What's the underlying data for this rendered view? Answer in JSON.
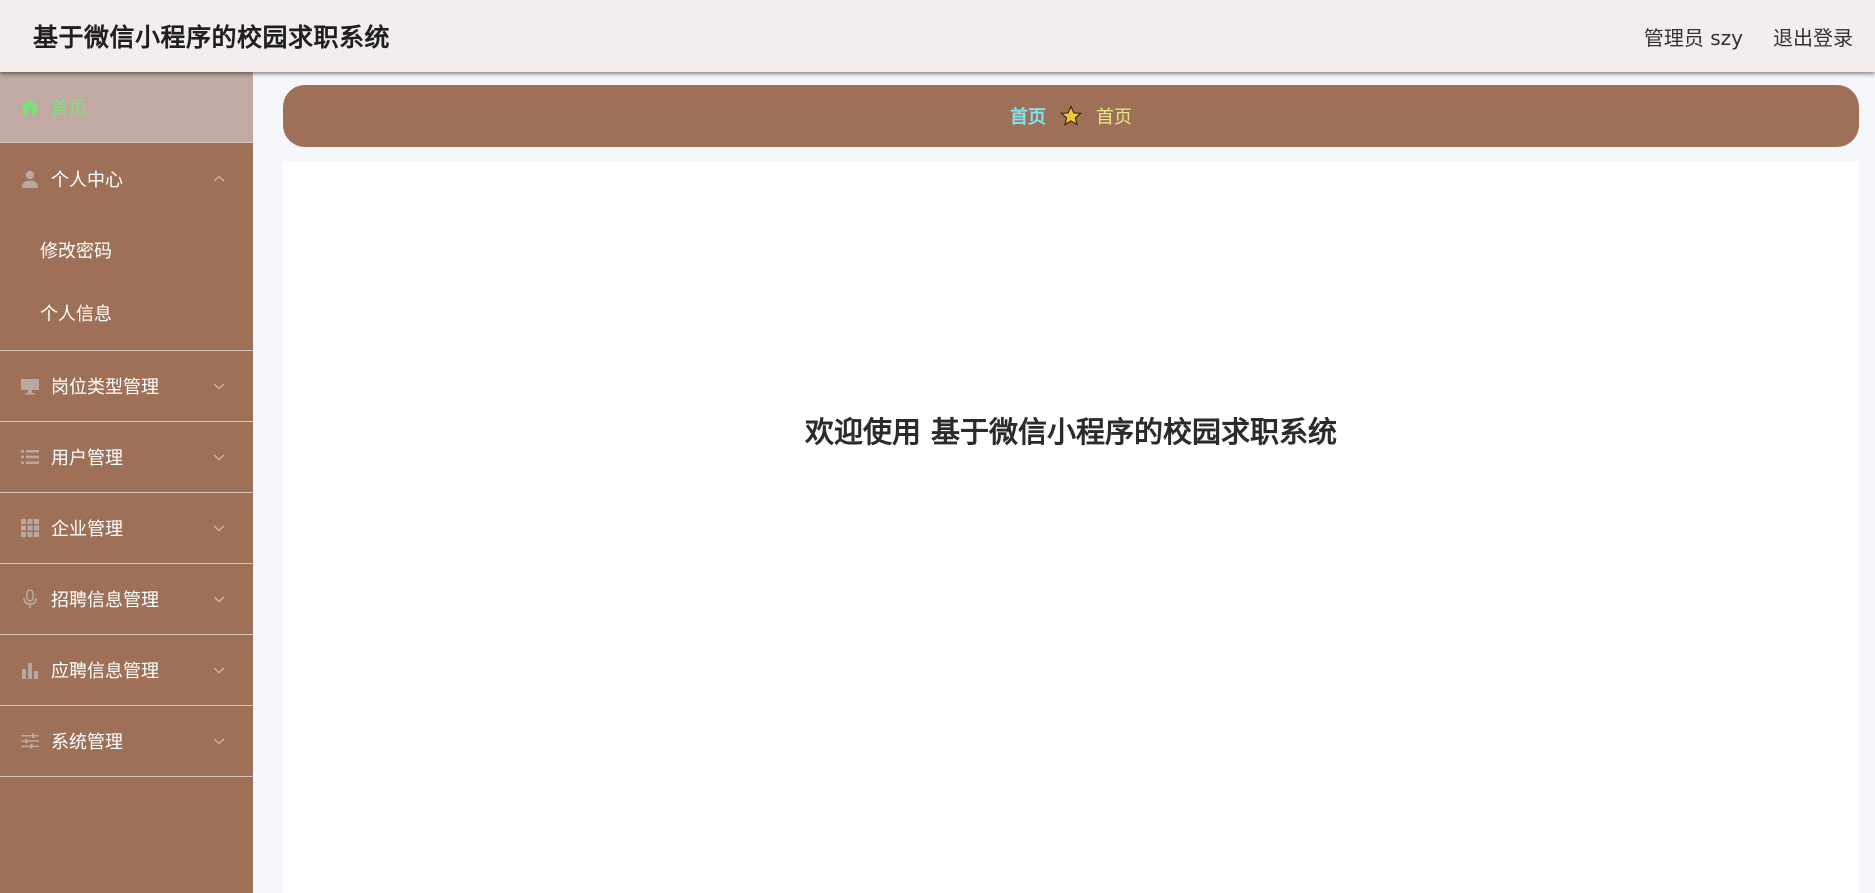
{
  "header": {
    "title": "基于微信小程序的校园求职系统",
    "user_label": "管理员 szy",
    "logout_label": "退出登录"
  },
  "sidebar": {
    "items": [
      {
        "label": "首页",
        "icon": "home-icon",
        "active": true
      },
      {
        "label": "个人中心",
        "icon": "user-icon",
        "expanded": true,
        "children": [
          {
            "label": "修改密码"
          },
          {
            "label": "个人信息"
          }
        ]
      },
      {
        "label": "岗位类型管理",
        "icon": "monitor-icon"
      },
      {
        "label": "用户管理",
        "icon": "list-icon"
      },
      {
        "label": "企业管理",
        "icon": "grid-icon"
      },
      {
        "label": "招聘信息管理",
        "icon": "microphone-icon"
      },
      {
        "label": "应聘信息管理",
        "icon": "bar-chart-icon"
      },
      {
        "label": "系统管理",
        "icon": "sliders-icon"
      }
    ]
  },
  "breadcrumb": {
    "first": "首页",
    "current": "首页",
    "separator_icon": "star-icon"
  },
  "main": {
    "welcome_text": "欢迎使用 基于微信小程序的校园求职系统"
  },
  "colors": {
    "accent_brown": "#9f7058",
    "active_text_green": "#7fe07b",
    "crumb_first_cyan": "#7fe3f0",
    "crumb_last_yellow": "#e8e68a",
    "star_yellow": "#f3c637"
  }
}
